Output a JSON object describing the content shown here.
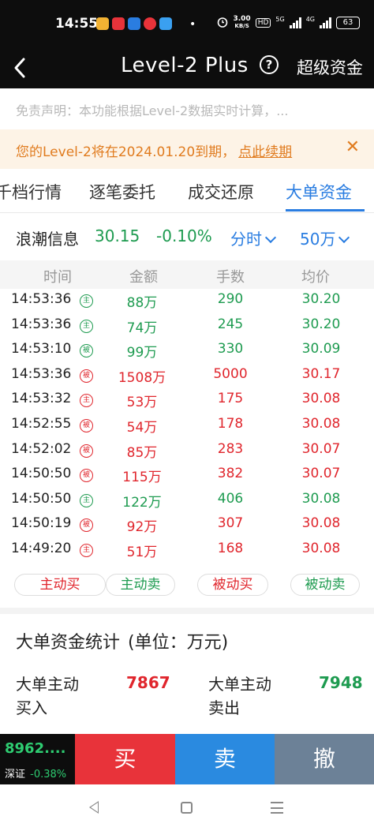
{
  "status_bar": {
    "time": "14:55",
    "dot": "•",
    "net_speed_value": "3.00",
    "net_speed_unit": "KB/S",
    "hd_label": "HD",
    "net_5g": "5G",
    "net_4g": "4G",
    "battery": "63"
  },
  "nav": {
    "back_icon": "chevron-left-icon",
    "title": "Level-2 Plus",
    "help_icon": "?",
    "right_label": "超级资金"
  },
  "disclaimer": "免责声明：本功能根据Level-2数据实时计算，...",
  "expiry": {
    "text": "您的Level-2将在2024.01.20到期，",
    "link": "点此续期",
    "close": "✕"
  },
  "tabs": [
    {
      "label": "千档行情",
      "active": false
    },
    {
      "label": "逐笔委托",
      "active": false
    },
    {
      "label": "成交还原",
      "active": false
    },
    {
      "label": "大单资金",
      "active": true
    }
  ],
  "stock": {
    "name": "浪潮信息",
    "price": "30.15",
    "change_pct": "-0.10%",
    "period": "分时",
    "amount_filter": "50万"
  },
  "columns": [
    "时间",
    "金额",
    "手数",
    "均价"
  ],
  "trades": [
    {
      "time": "14:53:36",
      "tag": "主",
      "side": "sell",
      "amount": "88万",
      "lots": "290",
      "avg": "30.20"
    },
    {
      "time": "14:53:36",
      "tag": "主",
      "side": "sell",
      "amount": "74万",
      "lots": "245",
      "avg": "30.20"
    },
    {
      "time": "14:53:10",
      "tag": "被",
      "side": "sell",
      "amount": "99万",
      "lots": "330",
      "avg": "30.09"
    },
    {
      "time": "14:53:36",
      "tag": "被",
      "side": "buy",
      "amount": "1508万",
      "lots": "5000",
      "avg": "30.17"
    },
    {
      "time": "14:53:32",
      "tag": "主",
      "side": "buy",
      "amount": "53万",
      "lots": "175",
      "avg": "30.08"
    },
    {
      "time": "14:52:55",
      "tag": "被",
      "side": "buy",
      "amount": "54万",
      "lots": "178",
      "avg": "30.08"
    },
    {
      "time": "14:52:02",
      "tag": "被",
      "side": "buy",
      "amount": "85万",
      "lots": "283",
      "avg": "30.07"
    },
    {
      "time": "14:50:50",
      "tag": "被",
      "side": "buy",
      "amount": "115万",
      "lots": "382",
      "avg": "30.07"
    },
    {
      "time": "14:50:50",
      "tag": "主",
      "side": "sell",
      "amount": "122万",
      "lots": "406",
      "avg": "30.08"
    },
    {
      "time": "14:50:19",
      "tag": "被",
      "side": "buy",
      "amount": "92万",
      "lots": "307",
      "avg": "30.08"
    },
    {
      "time": "14:49:20",
      "tag": "主",
      "side": "buy",
      "amount": "51万",
      "lots": "168",
      "avg": "30.08"
    }
  ],
  "filters": [
    {
      "label": "主动买",
      "color": "#e0262d"
    },
    {
      "label": "主动卖",
      "color": "#1e9b50"
    },
    {
      "label": "被动买",
      "color": "#e0262d"
    },
    {
      "label": "被动卖",
      "color": "#1e9b50"
    }
  ],
  "stats": {
    "title": "大单资金统计",
    "unit": "(单位：万元)",
    "active_buy_label_1": "大单主动",
    "active_buy_label_2": "买入",
    "active_buy_value": "7867",
    "active_sell_label_1": "大单主动",
    "active_sell_label_2": "卖出",
    "active_sell_value": "7948"
  },
  "bottom": {
    "index_value": "8962....",
    "index_name": "深证",
    "index_change": "-0.38%",
    "buy": "买",
    "sell": "卖",
    "cancel": "撤",
    "colors": {
      "buy": "#e8333a",
      "sell": "#2a8ae0",
      "cancel": "#6c8197"
    }
  }
}
